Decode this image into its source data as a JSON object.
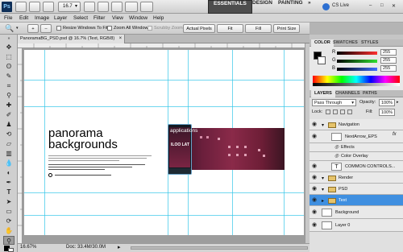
{
  "titlebar": {
    "logo": "Ps",
    "zoom_value": "16.7",
    "workspaces": [
      "ESSENTIALS",
      "DESIGN",
      "PAINTING",
      "»"
    ],
    "cs_live": "CS Live",
    "window_controls": [
      "–",
      "□",
      "✕"
    ]
  },
  "menu": [
    "File",
    "Edit",
    "Image",
    "Layer",
    "Select",
    "Filter",
    "View",
    "Window",
    "Help"
  ],
  "options": {
    "resize_windows": "Resize Windows To Fit",
    "zoom_all": "Zoom All Windows",
    "scrubby_zoom": "Scrubby Zoom",
    "actual_pixels": "Actual Pixels",
    "fit_screen": "Fit Screen",
    "fill_screen": "Fill Screen",
    "print_size": "Print Size"
  },
  "document": {
    "tab_title": "PanoramaBG_PSD.psd @ 16.7% (Text, RGB/8)",
    "heading_line1": "panorama",
    "heading_line2": "backgrounds",
    "phone_title": "applications",
    "phone_text": "ILOO LAT",
    "status_zoom": "16.67%",
    "status_doc": "Doc: 33.4M/30.0M"
  },
  "color_panel": {
    "tabs": [
      "COLOR",
      "SWATCHES",
      "STYLES"
    ],
    "sliders": [
      {
        "label": "R",
        "value": "255",
        "color": "#ff2f2f"
      },
      {
        "label": "G",
        "value": "255",
        "color": "#2fe02f"
      },
      {
        "label": "B",
        "value": "255",
        "color": "#3f6dff"
      }
    ]
  },
  "layers_panel": {
    "tabs": [
      "LAYERS",
      "CHANNELS",
      "PATHS"
    ],
    "blend_mode": "Pass Through",
    "opacity_label": "Opacity:",
    "opacity_value": "100%",
    "lock_label": "Lock:",
    "fill_label": "Fill:",
    "fill_value": "100%",
    "layers": [
      {
        "name": "Navigation",
        "kind": "group"
      },
      {
        "name": "NextArrow_EPS",
        "kind": "smart",
        "fx": "fx"
      },
      {
        "name": "Effects",
        "kind": "effect"
      },
      {
        "name": "Color Overlay",
        "kind": "effect"
      },
      {
        "name": "COMMON CONTROLS...",
        "kind": "text"
      },
      {
        "name": "Render",
        "kind": "group"
      },
      {
        "name": "PSD",
        "kind": "group"
      },
      {
        "name": "Text",
        "kind": "group",
        "selected": true
      },
      {
        "name": "Background",
        "kind": "layer"
      },
      {
        "name": "Layer 0",
        "kind": "layer"
      }
    ]
  }
}
